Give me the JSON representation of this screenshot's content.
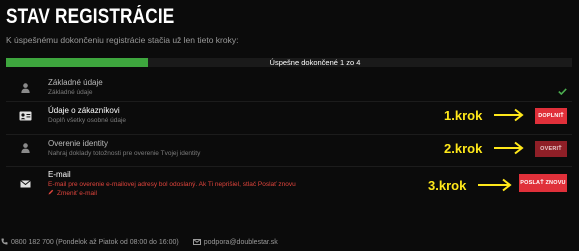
{
  "page": {
    "title": "STAV REGISTRÁCIE",
    "subtitle": "K úspešnému dokončeniu registrácie stačia už len tieto kroky:"
  },
  "progress": {
    "label": "Úspešne dokončené 1 zo 4",
    "completed": 1,
    "total": 4,
    "fill_color": "#3ea63e"
  },
  "steps": [
    {
      "icon": "user-icon",
      "title": "Základné údaje",
      "description": "Základné údaje",
      "status": "done",
      "status_icon": "checkmark-icon"
    },
    {
      "icon": "id-card-icon",
      "title": "Údaje o zákazníkovi",
      "description": "Doplň všetky osobné údaje",
      "button": "DOPLNIŤ",
      "button_color": "#e0303a",
      "annotation": "1.krok"
    },
    {
      "icon": "user-icon",
      "title": "Overenie identity",
      "description": "Nahraj doklady totožnosti pre overenie Tvojej identity",
      "button": "OVERIŤ",
      "button_color": "#8f1f27",
      "annotation": "2.krok"
    },
    {
      "icon": "envelope-icon",
      "title": "E-mail",
      "description": "E-mail pre overenie e-mailovej adresy bol odoslaný. Ak Ti neprišiel, stlač Poslať znovu",
      "link": "Zmeniť e-mail",
      "link_icon": "pencil-icon",
      "button": "POSLAŤ ZNOVU",
      "button_color": "#e0303a",
      "annotation": "3.krok"
    }
  ],
  "annotation_color": "#ffe81a",
  "footer": {
    "phone": "0800 182 700 (Pondelok až Piatok od 08:00 do 16:00)",
    "email": "podpora@doublestar.sk"
  }
}
